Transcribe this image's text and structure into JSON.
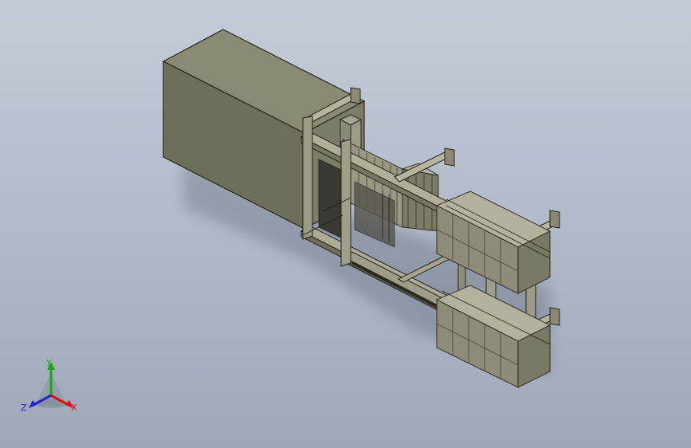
{
  "viewport": {
    "background_top": "#c4ccd8",
    "background_bottom": "#9ea8b8"
  },
  "model": {
    "body_color": "#6e6e5c",
    "body_light": "#8e8e78",
    "frame_color": "#a9a993",
    "frame_edge": "#2b2b25",
    "panel_color": "#8d8b78"
  },
  "triad": {
    "x_label": "X",
    "y_label": "Y",
    "z_label": "Z",
    "x_color": "#dd1111",
    "y_color": "#11aa11",
    "z_color": "#2222cc"
  }
}
